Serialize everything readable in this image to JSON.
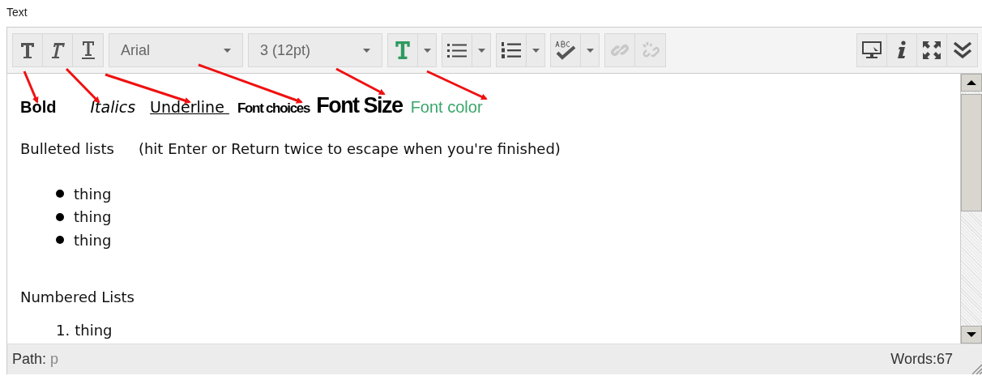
{
  "field_label": "Text",
  "toolbar": {
    "left_groups": [
      [
        {
          "kind": "bold"
        },
        {
          "kind": "italic"
        },
        {
          "kind": "underline"
        }
      ],
      [
        {
          "kind": "select",
          "value": "Arial"
        }
      ],
      [
        {
          "kind": "select",
          "value": "3 (12pt)"
        }
      ],
      [
        {
          "kind": "font-color"
        },
        {
          "kind": "dropdown"
        }
      ],
      [
        {
          "kind": "bullet-list"
        },
        {
          "kind": "dropdown"
        }
      ],
      [
        {
          "kind": "number-list"
        },
        {
          "kind": "dropdown"
        }
      ],
      [
        {
          "kind": "spellcheck"
        },
        {
          "kind": "dropdown"
        }
      ],
      [
        {
          "kind": "link",
          "disabled": true
        },
        {
          "kind": "unlink",
          "disabled": true
        }
      ]
    ],
    "right_group": [
      {
        "kind": "preview"
      },
      {
        "kind": "info"
      },
      {
        "kind": "fullscreen"
      },
      {
        "kind": "more"
      }
    ]
  },
  "content": {
    "format_samples": [
      {
        "kind": "bold",
        "text": "Bold"
      },
      {
        "kind": "italic",
        "text": "Italics"
      },
      {
        "kind": "underline",
        "text": "Underline "
      },
      {
        "kind": "typeface",
        "text": "Font choices"
      },
      {
        "kind": "large",
        "text": "Font Size"
      },
      {
        "kind": "colored",
        "text": "Font color",
        "color": "#3aa66a"
      }
    ],
    "bulleted_heading": "Bulleted lists",
    "bulleted_note": "(hit Enter or Return twice to escape when you're finished)",
    "bullet_items": [
      "thing",
      "thing",
      "thing"
    ],
    "numbered_heading": "Numbered Lists",
    "numbered_items": [
      {
        "number": "1.",
        "text": "thing"
      }
    ]
  },
  "status_bar": {
    "path_label": "Path:",
    "path": "p",
    "word_count": "Words:67"
  }
}
